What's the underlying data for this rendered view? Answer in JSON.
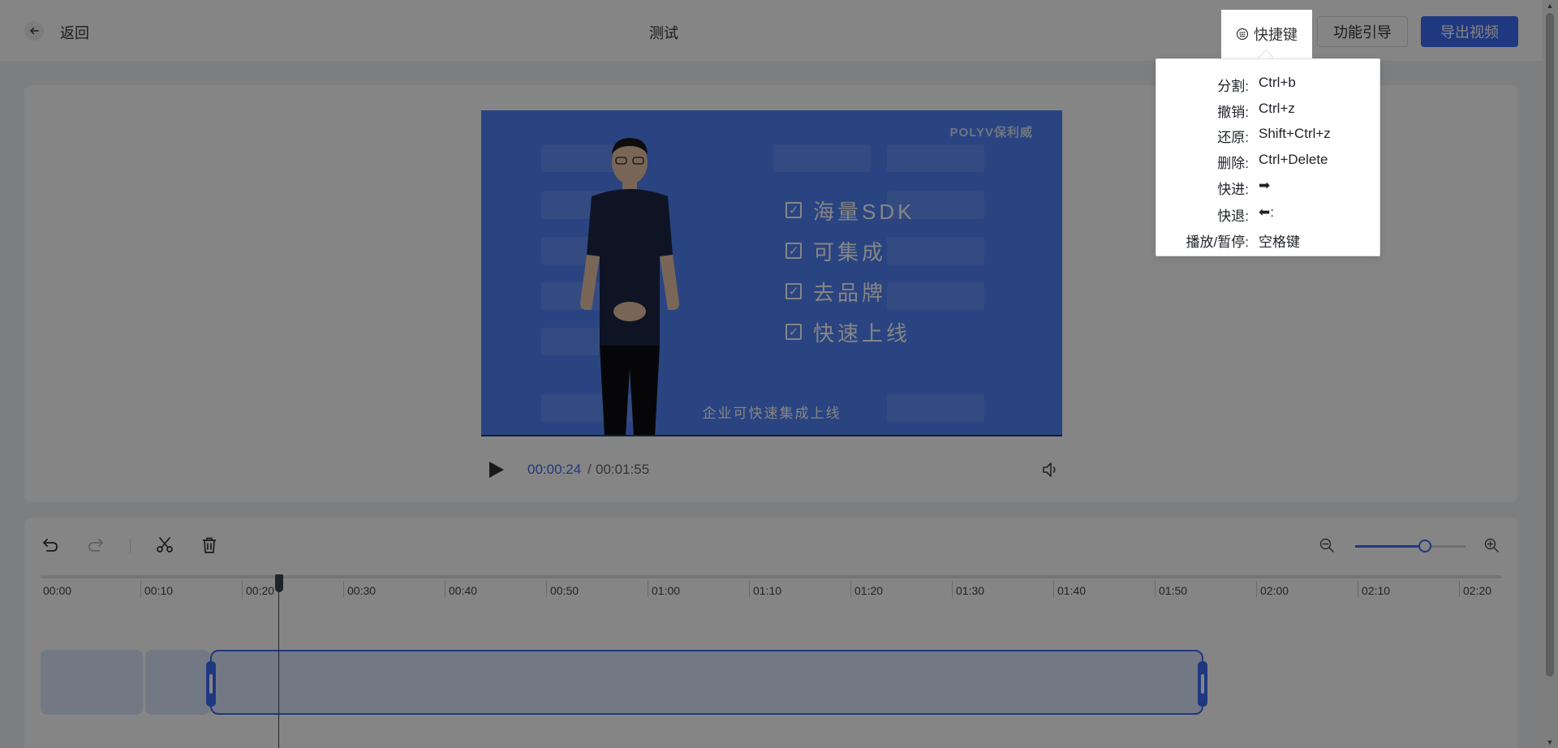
{
  "header": {
    "back_label": "返回",
    "title": "测试",
    "shortcut_button": "快捷键",
    "guide_button": "功能引导",
    "export_button": "导出视频"
  },
  "video": {
    "logo": "POLYV保利威",
    "features": [
      "海量SDK",
      "可集成",
      "去品牌",
      "快速上线"
    ],
    "subtitle": "企业可快速集成上线"
  },
  "player": {
    "current_time": "00:00:24",
    "separator": "/",
    "total_time": "00:01:55",
    "progress_fraction": 0.209
  },
  "timeline": {
    "ruler_labels": [
      "00:00",
      "00:10",
      "00:20",
      "00:30",
      "00:40",
      "00:50",
      "01:00",
      "01:10",
      "01:20",
      "01:30",
      "01:40",
      "01:50",
      "02:00",
      "02:10",
      "02:20"
    ],
    "zoom_level_fraction": 0.63,
    "clips_count": 3,
    "selected_clip_index": 2
  },
  "shortcuts_popup": {
    "items": [
      {
        "label": "分割:",
        "value": "Ctrl+b"
      },
      {
        "label": "撤销:",
        "value": "Ctrl+z"
      },
      {
        "label": "还原:",
        "value": "Shift+Ctrl+z"
      },
      {
        "label": "删除:",
        "value": "Ctrl+Delete"
      },
      {
        "label": "快进:",
        "value": "➡"
      },
      {
        "label": "快退:",
        "value": "⬅:"
      },
      {
        "label": "播放/暂停:",
        "value": "空格键"
      }
    ]
  },
  "colors": {
    "accent": "#3f6cf6",
    "video_bg": "#4f82f7",
    "clip_bg": "#dde6ff"
  }
}
